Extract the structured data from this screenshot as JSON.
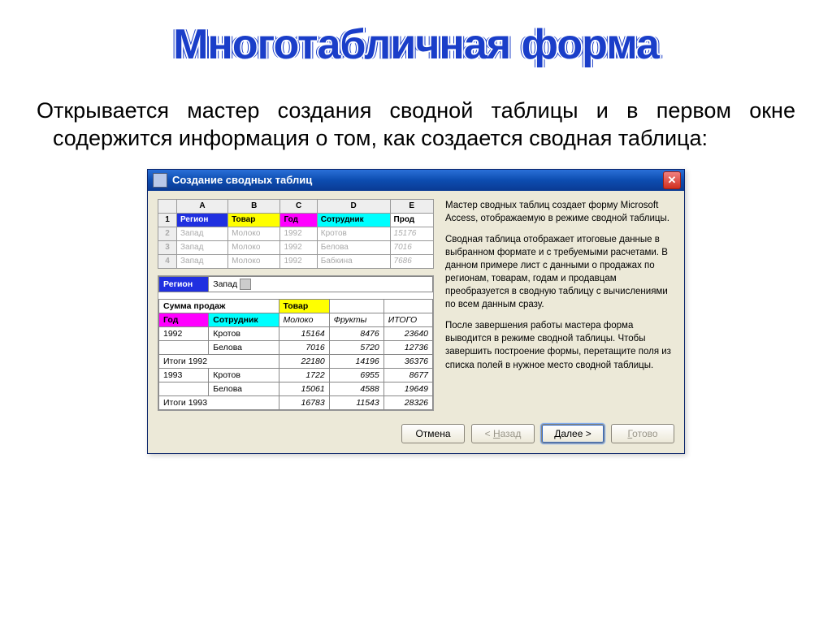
{
  "slide": {
    "title": "Многотабличная форма",
    "description": "Открывается мастер создания сводной таблицы и в первом окне содержится информация о том, как создается сводная таблица:"
  },
  "dialog": {
    "title": "Создание сводных таблиц",
    "close": "✕",
    "paragraphs": [
      "Мастер сводных таблиц создает форму Microsoft Access, отображаемую в режиме сводной таблицы.",
      "Сводная таблица отображает итоговые данные в выбранном формате и с требуемыми расчетами. В данном примере лист с данными о продажах по регионам, товарам, годам и продавцам преобразуется в сводную таблицу с вычислениями по всем данным сразу.",
      "После завершения работы мастера форма выводится в режиме сводной таблицы. Чтобы завершить построение формы, перетащите поля из списка полей в нужное место сводной таблицы."
    ]
  },
  "sourceGrid": {
    "cols": [
      "A",
      "B",
      "C",
      "D",
      "E"
    ],
    "headers": [
      "Регион",
      "Товар",
      "Год",
      "Сотрудник",
      "Прод"
    ],
    "rows": [
      {
        "n": "2",
        "cells": [
          "Запад",
          "Молоко",
          "1992",
          "Кротов",
          "15176"
        ]
      },
      {
        "n": "3",
        "cells": [
          "Запад",
          "Молоко",
          "1992",
          "Белова",
          "7016"
        ]
      },
      {
        "n": "4",
        "cells": [
          "Запад",
          "Молоко",
          "1992",
          "Бабкина",
          "7686"
        ]
      }
    ]
  },
  "pivot": {
    "regionLabel": "Регион",
    "regionValue": "Запад",
    "sumLabel": "Сумма продаж",
    "tovarLabel": "Товар",
    "godLabel": "Год",
    "sotrLabel": "Сотрудник",
    "columns": [
      "Молоко",
      "Фрукты",
      "ИТОГО"
    ],
    "data": [
      {
        "year": "1992",
        "emp": "Кротов",
        "vals": [
          "15164",
          "8476",
          "23640"
        ]
      },
      {
        "year": "",
        "emp": "Белова",
        "vals": [
          "7016",
          "5720",
          "12736"
        ]
      },
      {
        "year": "Итоги 1992",
        "emp": "",
        "vals": [
          "22180",
          "14196",
          "36376"
        ]
      },
      {
        "year": "1993",
        "emp": "Кротов",
        "vals": [
          "1722",
          "6955",
          "8677"
        ]
      },
      {
        "year": "",
        "emp": "Белова",
        "vals": [
          "15061",
          "4588",
          "19649"
        ]
      },
      {
        "year": "Итоги 1993",
        "emp": "",
        "vals": [
          "16783",
          "11543",
          "28326"
        ]
      }
    ]
  },
  "buttons": {
    "cancel": "Отмена",
    "back": "< Назад",
    "next": "Далее >",
    "finish": "Готово"
  }
}
